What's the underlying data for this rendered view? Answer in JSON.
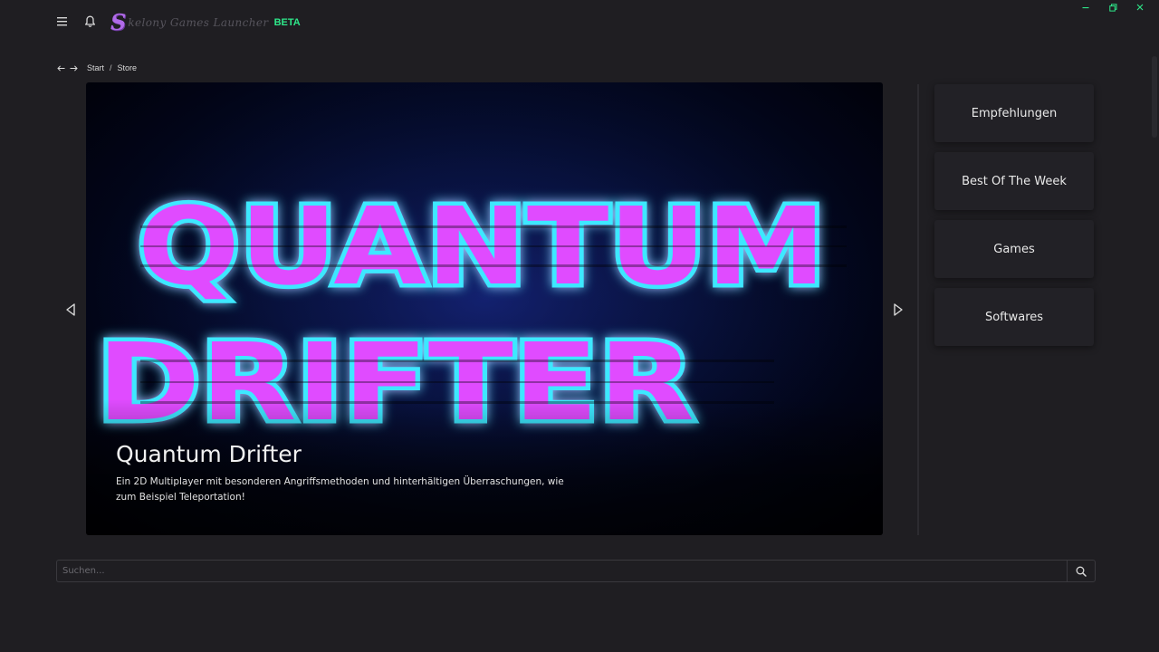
{
  "app": {
    "logo_letter": "S",
    "logo_text": "kelony Games Launcher",
    "beta_label": "BETA",
    "brand_color": "#b06ae8",
    "beta_color": "#2ee88a"
  },
  "icons": {
    "menu": "hamburger-menu-icon",
    "notifications": "bell-icon",
    "back": "arrow-left-icon",
    "forward": "arrow-right-icon",
    "prev": "triangle-left-icon",
    "next": "triangle-right-icon",
    "search": "search-icon",
    "minimize": "minimize-icon",
    "maximize": "maximize-icon",
    "close": "close-icon"
  },
  "window_controls_color": "#2ee88a",
  "breadcrumb": {
    "items": [
      "Start",
      "Store"
    ],
    "separator": "/"
  },
  "featured": {
    "art_text_line1": "QUANTUM",
    "art_text_line2": "DRIFTER",
    "title": "Quantum Drifter",
    "description": "Ein 2D Multiplayer mit besonderen Angriffsmethoden und hinterhältigen Überraschungen, wie zum Beispiel Teleportation!",
    "art_fill_color": "#e04cff",
    "art_glow_color": "#3ce8ff"
  },
  "categories": [
    {
      "label": "Empfehlungen"
    },
    {
      "label": "Best Of The Week"
    },
    {
      "label": "Games"
    },
    {
      "label": "Softwares"
    }
  ],
  "search": {
    "placeholder": "Suchen...",
    "value": ""
  }
}
